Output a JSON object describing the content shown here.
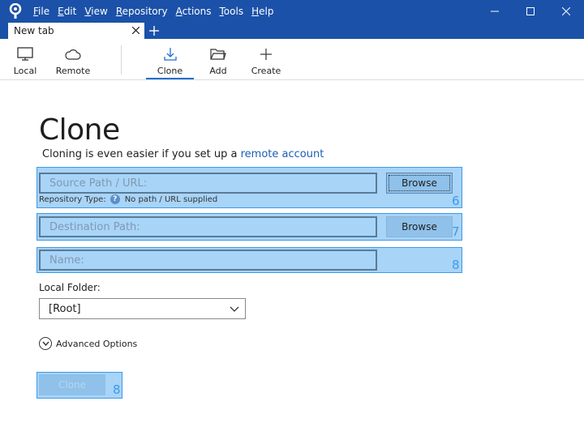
{
  "menu": {
    "items": [
      {
        "mn": "F",
        "rest": "ile"
      },
      {
        "mn": "E",
        "rest": "dit"
      },
      {
        "mn": "V",
        "rest": "iew"
      },
      {
        "mn": "R",
        "rest": "epository"
      },
      {
        "mn": "A",
        "rest": "ctions"
      },
      {
        "mn": "T",
        "rest": "ools"
      },
      {
        "mn": "H",
        "rest": "elp"
      }
    ]
  },
  "tab": {
    "label": "New tab"
  },
  "toolbar": {
    "local": "Local",
    "remote": "Remote",
    "clone": "Clone",
    "add": "Add",
    "create": "Create"
  },
  "main": {
    "title": "Clone",
    "subtitle_prefix": "Cloning is even easier if you set up a ",
    "subtitle_link": "remote account",
    "source_placeholder": "Source Path / URL:",
    "browse": "Browse",
    "repo_type_label": "Repository Type:",
    "repo_type_value": "No path / URL supplied",
    "dest_placeholder": "Destination Path:",
    "name_placeholder": "Name:",
    "local_folder_label": "Local Folder:",
    "local_folder_value": "[Root]",
    "advanced": "Advanced Options",
    "clone_button": "Clone"
  },
  "overlays": {
    "source_num": "6",
    "dest_num": "7",
    "name_num": "8",
    "clone_num": "8"
  },
  "colors": {
    "titlebar": "#1b51a8",
    "highlight": "#a8d4f7",
    "highlight_border": "#3d9ae8",
    "link": "#1a5fb4"
  }
}
